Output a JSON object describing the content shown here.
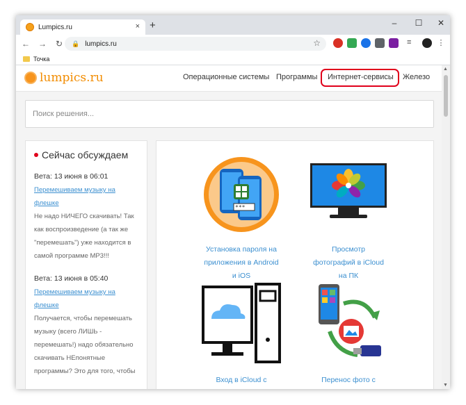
{
  "browser": {
    "tab_title": "Lumpics.ru",
    "tab_close": "×",
    "new_tab": "+",
    "url": "lumpics.ru",
    "bookmark": "Точка"
  },
  "site": {
    "logo": "lumpics.ru",
    "menu": [
      "Операционные системы",
      "Программы",
      "Интернет-сервисы",
      "Железо"
    ],
    "search_placeholder": "Поиск решения..."
  },
  "sidebar": {
    "title": "Сейчас обсуждаем",
    "comments": [
      {
        "who": "Вета: 13 июня в 06:01",
        "link": [
          "Перемешиваем музыку на",
          "флешке"
        ],
        "text": [
          "Не надо НИЧЕГО скачивать! Так",
          "как воспроизведение (а так же",
          "\"перемешать\") уже находится в",
          "самой программе МР3!!!"
        ]
      },
      {
        "who": "Вета: 13 июня в 05:40",
        "link": [
          "Перемешиваем музыку на",
          "флешке"
        ],
        "text": [
          "Получается, чтобы перемешать",
          "музыку (всего ЛИШЬ -",
          "перемешать!) надо обязательно",
          "скачивать НЕпонятные",
          "программы? Это для того, чтобы"
        ]
      }
    ]
  },
  "articles": [
    {
      "lines": [
        "Установка пароля на",
        "приложения в Android",
        "и iOS"
      ]
    },
    {
      "lines": [
        "Просмотр",
        "фотографий в iCloud",
        "на ПК"
      ]
    },
    {
      "lines": [
        "Вход в iCloud с"
      ]
    },
    {
      "lines": [
        "Перенос фото с"
      ]
    }
  ]
}
